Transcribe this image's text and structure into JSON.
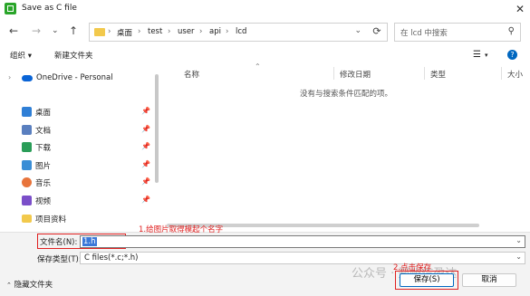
{
  "window": {
    "title": "Save as C file"
  },
  "nav": {
    "back_icon": "arrow-left-icon",
    "forward_icon": "arrow-right-icon",
    "recent_icon": "chevron-down-icon",
    "up_icon": "arrow-up-icon",
    "breadcrumb": [
      "桌面",
      "test",
      "user",
      "api",
      "lcd"
    ],
    "search_placeholder": "在 lcd 中搜索"
  },
  "toolbar": {
    "organize": "组织 ▾",
    "new_folder": "新建文件夹"
  },
  "sidebar": {
    "onedrive": "OneDrive - Personal",
    "items": [
      {
        "label": "桌面",
        "icon": "desktop-icon",
        "color": "#2f7fd6"
      },
      {
        "label": "文档",
        "icon": "document-icon",
        "color": "#5a7fbf"
      },
      {
        "label": "下载",
        "icon": "download-icon",
        "color": "#2a9d58"
      },
      {
        "label": "图片",
        "icon": "picture-icon",
        "color": "#3a8ed6"
      },
      {
        "label": "音乐",
        "icon": "music-icon",
        "color": "#e8743b"
      },
      {
        "label": "视频",
        "icon": "video-icon",
        "color": "#7b4fc9"
      },
      {
        "label": "项目资料",
        "icon": "folder-icon",
        "color": "#f2c94c"
      }
    ]
  },
  "list": {
    "columns": [
      "名称",
      "修改日期",
      "类型",
      "大小"
    ],
    "empty_message": "没有与搜索条件匹配的项。"
  },
  "form": {
    "filename_label": "文件名(N):",
    "filename_value": "1.h",
    "filetype_label": "保存类型(T):",
    "filetype_value": "C files(*.c;*.h)"
  },
  "annotations": {
    "step1": "1.给图片取得模起个名字",
    "step2": "2.点击保存"
  },
  "buttons": {
    "hide_folders": "隐藏文件夹",
    "save": "保存(S)",
    "cancel": "取消"
  },
  "watermark": "公众号 · 郑州信盈达",
  "colors": {
    "accent": "#0067c0",
    "annotation": "#e02020"
  }
}
